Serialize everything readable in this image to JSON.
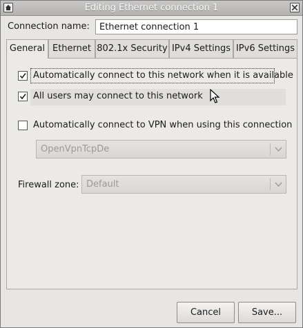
{
  "window": {
    "title": "Editing Ethernet connection 1"
  },
  "connection": {
    "label": "Connection name:",
    "value": "Ethernet connection 1"
  },
  "tabs": [
    {
      "label": "General",
      "active": true
    },
    {
      "label": "Ethernet",
      "active": false
    },
    {
      "label": "802.1x Security",
      "active": false
    },
    {
      "label": "IPv4 Settings",
      "active": false
    },
    {
      "label": "IPv6 Settings",
      "active": false
    }
  ],
  "general": {
    "auto_connect": {
      "label": "Automatically connect to this network when it is available",
      "checked": true
    },
    "all_users": {
      "label": "All users may connect to this network",
      "checked": true
    },
    "auto_vpn": {
      "label": "Automatically connect to VPN when using this connection",
      "checked": false
    },
    "vpn_select": {
      "value": "OpenVpnTcpDe",
      "enabled": false
    },
    "firewall": {
      "label": "Firewall zone:",
      "value": "Default",
      "enabled": false
    }
  },
  "buttons": {
    "cancel": "Cancel",
    "save": "Save..."
  }
}
